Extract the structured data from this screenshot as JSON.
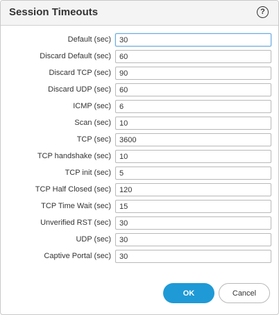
{
  "dialog": {
    "title": "Session Timeouts",
    "help_icon": "?"
  },
  "fields": [
    {
      "label": "Default (sec)",
      "value": "30"
    },
    {
      "label": "Discard Default (sec)",
      "value": "60"
    },
    {
      "label": "Discard TCP (sec)",
      "value": "90"
    },
    {
      "label": "Discard UDP (sec)",
      "value": "60"
    },
    {
      "label": "ICMP (sec)",
      "value": "6"
    },
    {
      "label": "Scan (sec)",
      "value": "10"
    },
    {
      "label": "TCP (sec)",
      "value": "3600"
    },
    {
      "label": "TCP handshake (sec)",
      "value": "10"
    },
    {
      "label": "TCP init (sec)",
      "value": "5"
    },
    {
      "label": "TCP Half Closed (sec)",
      "value": "120"
    },
    {
      "label": "TCP Time Wait (sec)",
      "value": "15"
    },
    {
      "label": "Unverified RST (sec)",
      "value": "30"
    },
    {
      "label": "UDP (sec)",
      "value": "30"
    },
    {
      "label": "Captive Portal (sec)",
      "value": "30"
    }
  ],
  "buttons": {
    "ok": "OK",
    "cancel": "Cancel"
  },
  "colors": {
    "primary_button": "#1f9ad6",
    "header_background": "#f4f4f4",
    "focus_border": "#6aa9dc"
  }
}
